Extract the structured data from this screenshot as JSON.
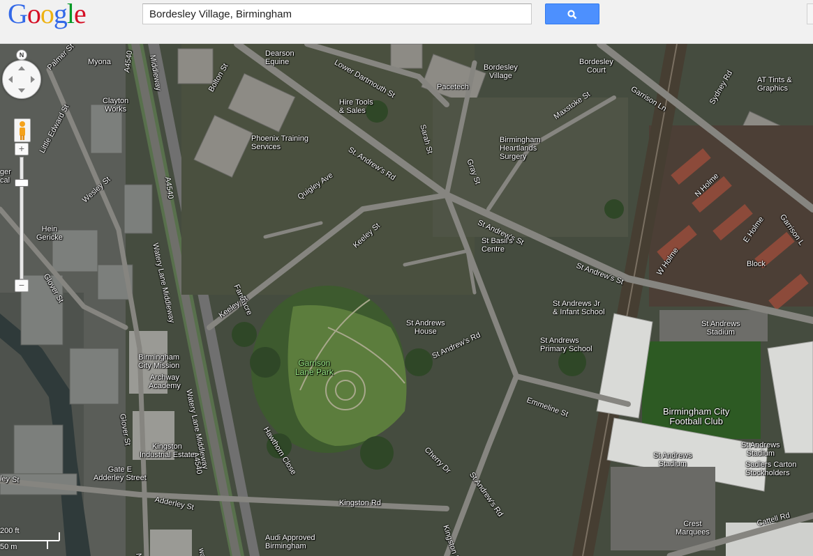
{
  "header": {
    "logo_letters": [
      {
        "ch": "G",
        "color": "#3369e8"
      },
      {
        "ch": "o",
        "color": "#d50f25"
      },
      {
        "ch": "o",
        "color": "#eeb211"
      },
      {
        "ch": "g",
        "color": "#3369e8"
      },
      {
        "ch": "l",
        "color": "#009925"
      },
      {
        "ch": "e",
        "color": "#d50f25"
      }
    ],
    "search_value": "Bordesley Village, Birmingham",
    "search_icon": "magnifier-icon"
  },
  "map": {
    "controls": {
      "compass": "N",
      "zoom_in": "+",
      "zoom_out": "−",
      "pan_icon": "pan-arrows-icon",
      "pegman_icon": "pegman-icon"
    },
    "scale": {
      "top_label": "200 ft",
      "bottom_label": "50 m"
    },
    "labels": {
      "myona": "Myona",
      "a4540_top": "A4540",
      "middleway_top": "Middleway",
      "palmer_st": "Palmer St",
      "dearson": "Dearson\nEquine",
      "lower_dartmouth": "Lower Dartmouth St",
      "bordesley_village": "Bordesley\nVillage",
      "bordesley_court": "Bordesley\nCourt",
      "garrison_ln": "Garrison Ln",
      "at_tints": "AT Tints &\nGraphics",
      "sydney_rd": "Sydney Rd",
      "clayton_works": "Clayton\nWorks",
      "bolton_st": "Bolton St",
      "pacetech": "Pacetech",
      "hire_tools": "Hire Tools\n& Sales",
      "sarah_st": "Sarah St",
      "maxstoke_st": "Maxstoke St",
      "little_edward": "Little Edward St",
      "phoenix": "Phoenix Training\nServices",
      "st_andrews_rd": "St. Andrew's Rd",
      "gray_st": "Gray St",
      "heartlands": "Birmingham\nHeartlands\nSurgery",
      "a4540_mid": "A4540",
      "watery_lane_1": "Watery Lane Middleway",
      "wesley_st": "Wesley St",
      "quigley_ave": "Quigley Ave",
      "n_holme": "N Holme",
      "garrison_ln_2": "Garrison L",
      "hein_gericke": "Hein\nGericke",
      "keeley_st_1": "Keeley St",
      "st_andrews_st_1": "St Andrew's St",
      "st_basils": "St Basil's\nCentre",
      "e_holme": "E Holme",
      "glover_st_1": "Glover St",
      "farmacre": "Farmacre",
      "st_andrews_st_2": "St Andrew's St",
      "w_holme": "W Holme",
      "block": "Block",
      "keeley_st_2": "Keeley St",
      "st_andrews_jr": "St Andrews Jr\n& Infant School",
      "st_andrews_house": "St Andrews\nHouse",
      "st_andrews_stadium_1": "St Andrews\nStadium",
      "st_andrews_primary": "St Andrews\nPrimary School",
      "garrison_park": "Garrison\nLane Park",
      "st_andrews_rd_2": "St Andrew's Rd",
      "birmingham_city_mission": "Birmingham\nCity Mission",
      "archway": "Archway\nAcademy",
      "emmeline_st": "Emmeline St",
      "bcfc": "Birmingham City\nFootball Club",
      "glover_st_2": "Glover St",
      "hawthorn_close": "Hawthorn Close",
      "watery_lane_2": "Watery Lane Middleway",
      "a4540_low": "A4540",
      "kingston_ind": "Kingston\nIndustrial Estate",
      "cherry_dr": "Cherry Dr",
      "st_andrews_stadium_2": "St Andrews\nStadium",
      "st_andrews_stadium_3": "St Andrews\nStadium",
      "sadlers": "Sadlers Carton\nStockholders",
      "st_andrews_rd_3": "St Andrew's Rd",
      "gate_e": "Gate E\nAdderley Street",
      "ley_st": "ley St",
      "adderley_st": "Adderley St",
      "kingston_rd_1": "Kingston Rd",
      "kingston_rd_2": "Kingston Rd",
      "crest": "Crest\nMarquees",
      "cattell_rd": "Cattell Rd",
      "audi": "Audi Approved\nBirmingham",
      "new_st": "New",
      "way": "way",
      "ger_cal": "ger\ncal"
    }
  }
}
